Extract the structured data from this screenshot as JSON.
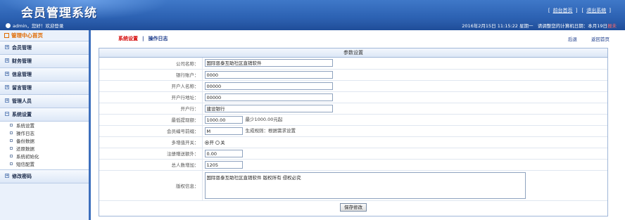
{
  "header": {
    "title": "会员管理系统",
    "links": {
      "home": "前台首页",
      "logout": "退出系统"
    }
  },
  "subbar": {
    "welcome": "admin，您好！欢迎登录",
    "datetime": "2016年2月15日 11:15:22 星期一",
    "notice_prefix": "请调整您的计算机日期：本月19日",
    "notice_suffix": "报未"
  },
  "sidebar": {
    "heading": "管理中心首页",
    "groups": [
      {
        "label": "会员管理"
      },
      {
        "label": "财务管理"
      },
      {
        "label": "信息管理"
      },
      {
        "label": "留言管理"
      },
      {
        "label": "管理人员"
      },
      {
        "label": "系统设置"
      }
    ],
    "sub_items": [
      "系统设置",
      "操作日志",
      "备份数据",
      "还原数据",
      "系统初始化",
      "短信配置"
    ],
    "last_group": "修改密码"
  },
  "main": {
    "breadcrumb": {
      "active": "系统设置",
      "sep": "|",
      "other": "操作日志"
    },
    "top_links": {
      "back": "后退",
      "home": "返回首页"
    },
    "panel_title": "参数设置",
    "fields": {
      "company": {
        "label": "公司名称：",
        "value": "国际恩泰互助社区直销软件"
      },
      "bank_account": {
        "label": "银行账户：",
        "value": "0000"
      },
      "account_name": {
        "label": "开户人名称：",
        "value": "00000"
      },
      "bank_address": {
        "label": "开户行地址：",
        "value": "00000"
      },
      "bank": {
        "label": "开户行：",
        "value": "建设银行"
      },
      "min_withdraw": {
        "label": "最低提现额：",
        "value": "1000.00",
        "hint": "最少1000.00元起"
      },
      "member_prefix": {
        "label": "会员编号前缀：",
        "value": "M",
        "hint": "生成规则：根据需求设置"
      },
      "multi_account": {
        "label": "多增值开关：",
        "option_on": "开",
        "option_off": "关"
      },
      "registration_fee": {
        "label": "注册赠送额外：",
        "value": "0.00"
      },
      "total_increase": {
        "label": "总人数增加：",
        "value": "1205"
      },
      "copyright": {
        "label": "版权信息：",
        "value": "国际恩泰互助社区直销软件 版权所有 侵权必究"
      }
    },
    "save_button": "保存修改"
  }
}
